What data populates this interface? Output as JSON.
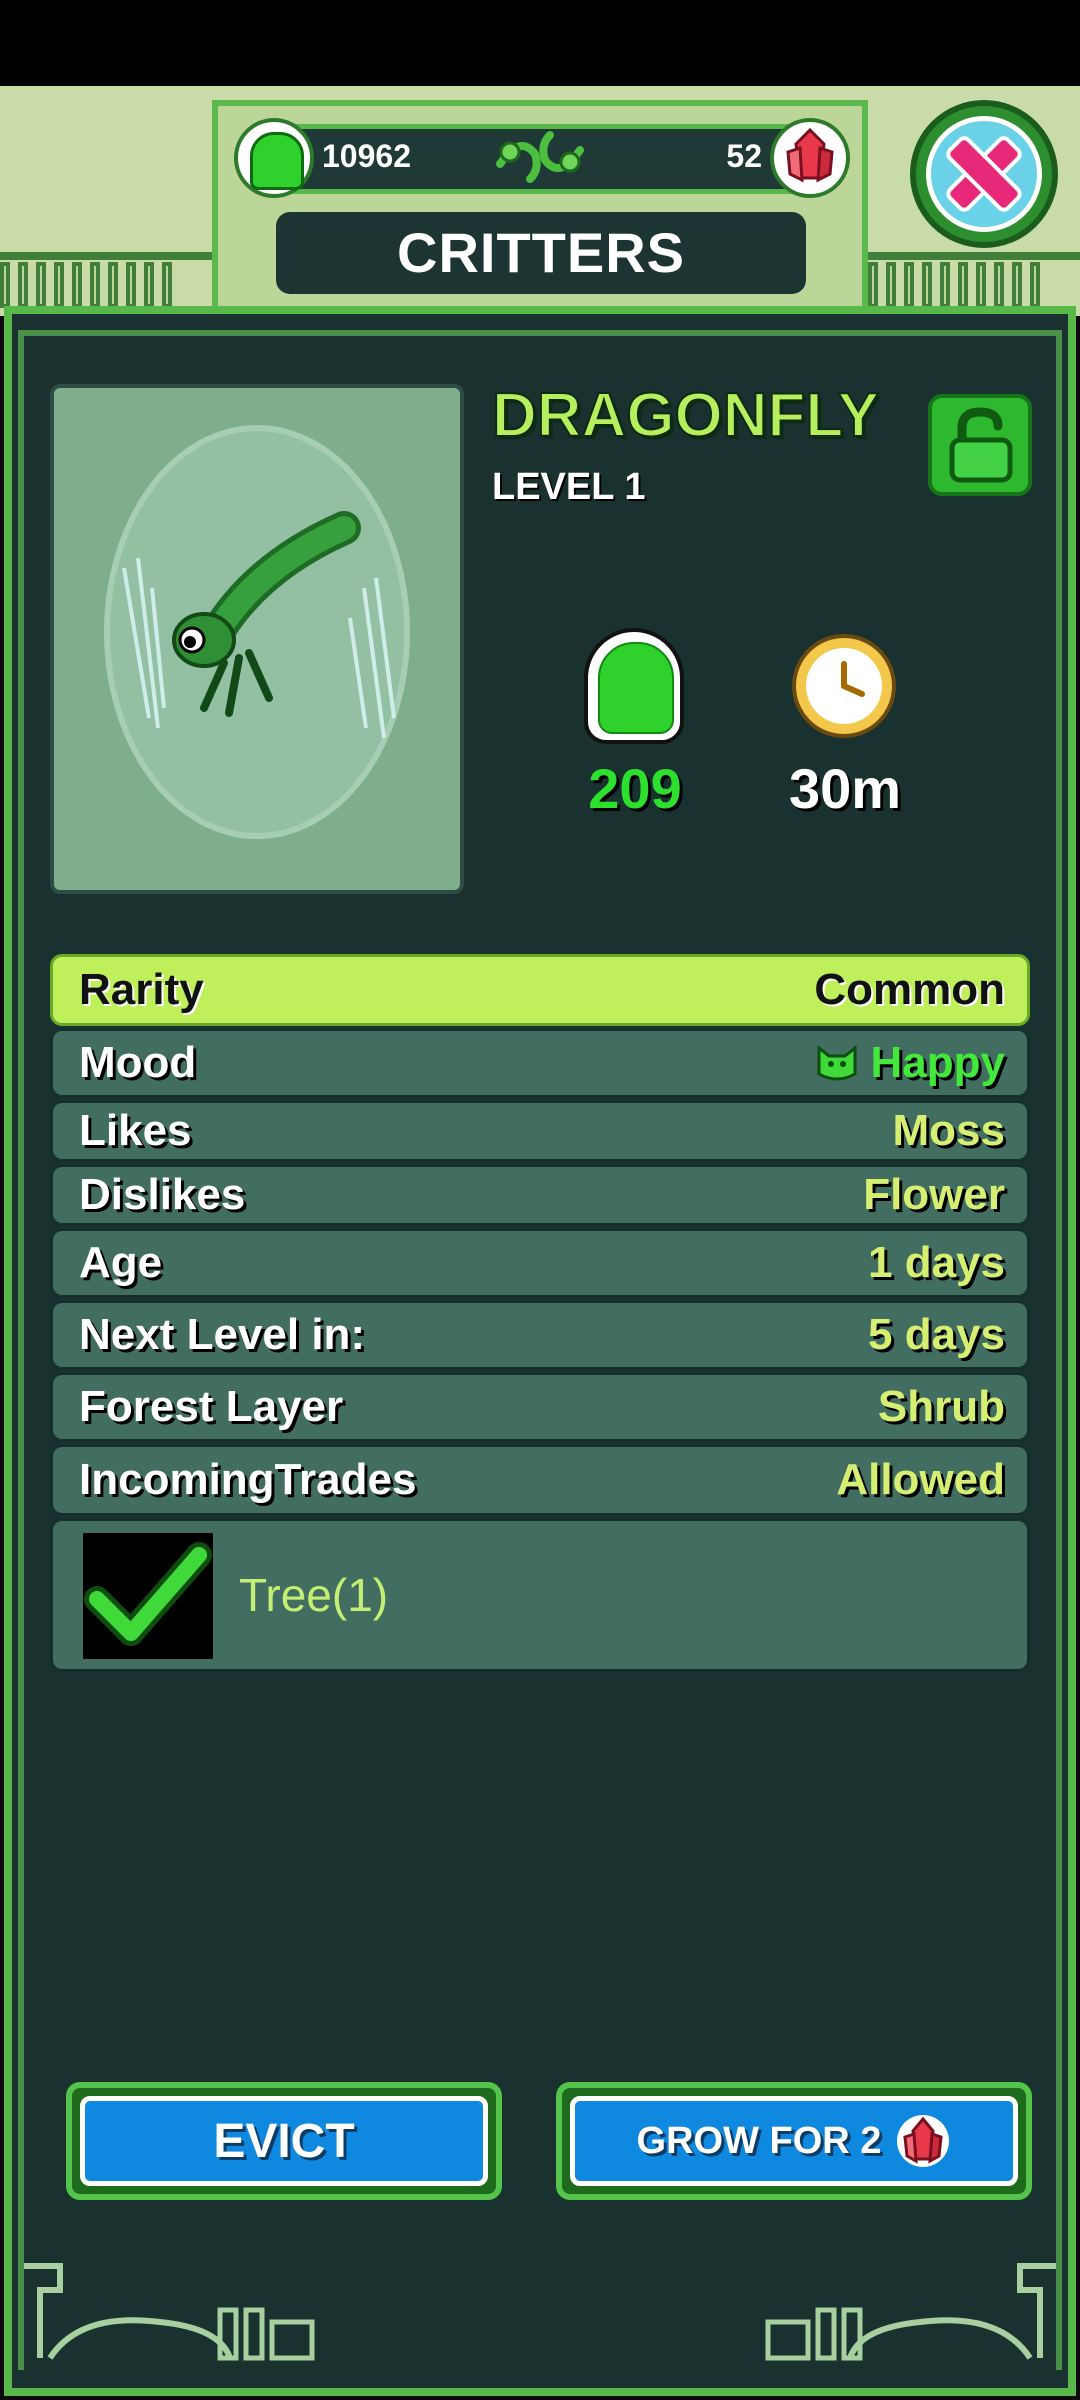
{
  "header": {
    "jelly_count": "10962",
    "gem_count": "52",
    "title": "CRITTERS"
  },
  "critter": {
    "name": "DRAGONFLY",
    "level": "LEVEL 1",
    "jelly_value": "209",
    "timer_value": "30m"
  },
  "info_rows": [
    {
      "label": "Rarity",
      "value": "Common"
    },
    {
      "label": "Mood",
      "value": "Happy"
    },
    {
      "label": "Likes",
      "value": "Moss"
    },
    {
      "label": "Dislikes",
      "value": "Flower"
    },
    {
      "label": "Age",
      "value": "1 days"
    },
    {
      "label": "Next Level in:",
      "value": "5 days"
    },
    {
      "label": "Forest Layer",
      "value": "Shrub"
    },
    {
      "label": "IncomingTrades",
      "value": "Allowed"
    }
  ],
  "trade_option": {
    "label": "Tree(1)",
    "checked": true
  },
  "buttons": {
    "evict": "EVICT",
    "grow": "GROW FOR 2"
  },
  "colors": {
    "panel_bg": "#193230",
    "accent_green": "#58b84a",
    "highlight_row": "#bff05c",
    "value_text": "#d6ef73",
    "button_blue": "#0f88e0"
  },
  "icons": [
    "jelly-icon",
    "gem-icon",
    "vine-icon",
    "close-icon",
    "lock-icon",
    "timer-icon",
    "mood-cat-icon",
    "checkmark-icon"
  ]
}
